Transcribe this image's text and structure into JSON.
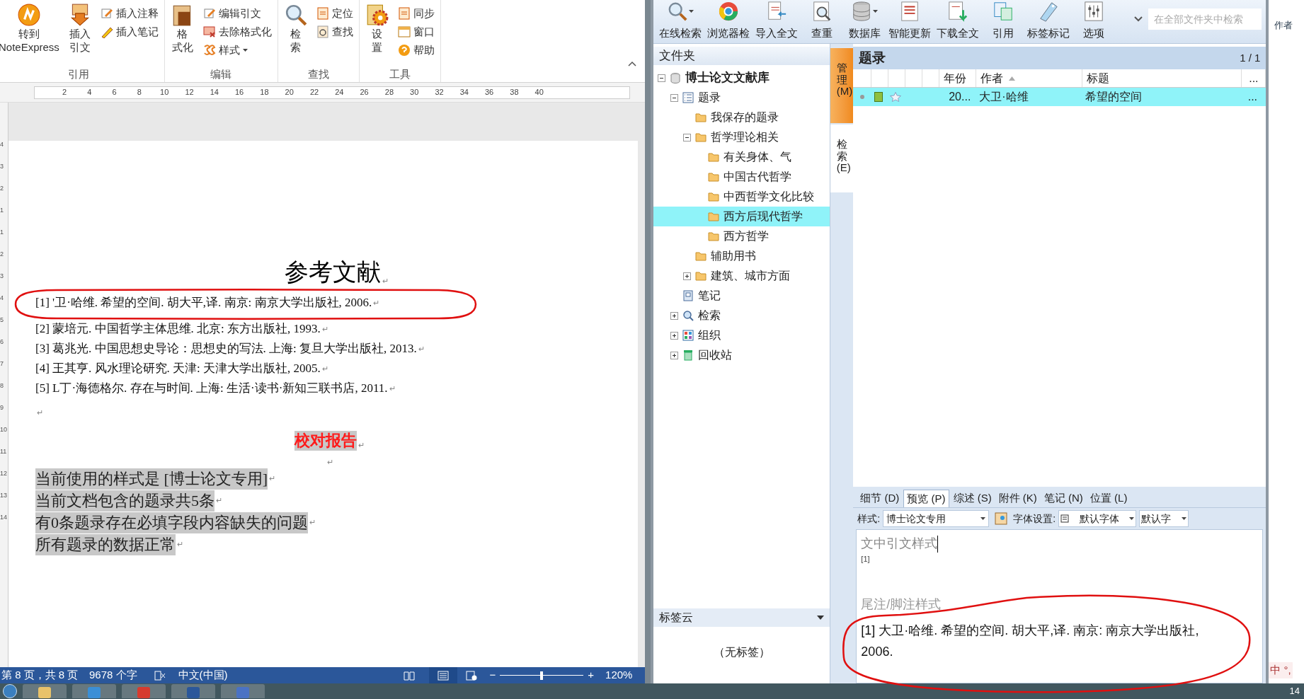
{
  "word": {
    "ribbon_groups": [
      {
        "label": "引用",
        "large": [
          {
            "lines": [
              "转到",
              "NoteExpress"
            ]
          },
          {
            "lines": [
              "插入",
              "引文"
            ]
          }
        ],
        "small": [
          {
            "label": "插入注释",
            "dropdown": false
          },
          {
            "label": "插入笔记",
            "dropdown": false
          }
        ]
      },
      {
        "label": "编辑",
        "large": [
          {
            "lines": [
              "格",
              "式化"
            ]
          }
        ],
        "small": [
          {
            "label": "编辑引文",
            "dropdown": false
          },
          {
            "label": "去除格式化",
            "dropdown": false
          },
          {
            "label": "样式",
            "dropdown": true
          }
        ]
      },
      {
        "label": "查找",
        "large": [
          {
            "lines": [
              "检",
              "索"
            ]
          }
        ],
        "small": [
          {
            "label": "定位",
            "dropdown": false
          },
          {
            "label": "查找",
            "dropdown": false
          }
        ]
      },
      {
        "label": "工具",
        "large": [
          {
            "lines": [
              "设",
              "置"
            ]
          }
        ],
        "small": [
          {
            "label": "同步",
            "dropdown": false
          },
          {
            "label": "窗口",
            "dropdown": false
          },
          {
            "label": "帮助",
            "dropdown": false
          }
        ]
      }
    ],
    "ruler_labels": [
      "2",
      "4",
      "6",
      "8",
      "10",
      "12",
      "14",
      "16",
      "18",
      "20",
      "22",
      "24",
      "26",
      "28",
      "30",
      "32",
      "34",
      "36",
      "38",
      "40"
    ],
    "vertical_ruler_labels": [
      "4",
      "3",
      "2",
      "1",
      "1",
      "2",
      "3",
      "4",
      "5",
      "6",
      "7",
      "8",
      "9",
      "10",
      "11",
      "12",
      "13",
      "14"
    ],
    "paragraph_mark": "↵",
    "title": "参考文献",
    "references": [
      "[1] '卫·哈维. 希望的空间. 胡大平,译. 南京: 南京大学出版社, 2006.",
      "[2]  蒙培元. 中国哲学主体思维. 北京: 东方出版社, 1993.",
      "[3]  葛兆光. 中国思想史导论：思想史的写法. 上海: 复旦大学出版社, 2013.",
      "[4]  王其亨. 风水理论研究. 天津: 天津大学出版社, 2005.",
      "[5] L丁·海德格尔. 存在与时间. 上海: 生活·读书·新知三联书店, 2011."
    ],
    "report_title": "校对报告",
    "report_lines": [
      "当前使用的样式是 [博士论文专用]",
      "当前文档包含的题录共5条",
      "有0条题录存在必填字段内容缺失的问题",
      "所有题录的数据正常"
    ],
    "status_bar": {
      "page": "第 8 页，共 8 页",
      "words": "9678 个字",
      "language": "中文(中国)",
      "zoom_out": "−",
      "zoom_slider": {
        "level": 0.5
      },
      "zoom_in": "+",
      "zoom": "120%"
    }
  },
  "noteexpress": {
    "toolbar": [
      {
        "label": "在线检索",
        "dropdown": true
      },
      {
        "label": "浏览器检",
        "dropdown": false
      },
      {
        "label": "导入全文",
        "dropdown": false
      },
      {
        "label": "查重",
        "dropdown": false
      },
      {
        "label": "数据库",
        "dropdown": true
      },
      {
        "label": "智能更新",
        "dropdown": false
      },
      {
        "label": "下载全文",
        "dropdown": false
      },
      {
        "label": "引用",
        "dropdown": false
      },
      {
        "label": "标签标记",
        "dropdown": false
      },
      {
        "label": "选项",
        "dropdown": false
      }
    ],
    "search": {
      "placeholder": "在全部文件夹中检索"
    },
    "folders_title": "文件夹",
    "tree": [
      {
        "label": "博士论文文献库",
        "kind": "database",
        "expanded": true,
        "selected": false,
        "children": [
          {
            "label": "题录",
            "kind": "list",
            "expanded": true,
            "selected": false,
            "children": [
              {
                "label": "我保存的题录",
                "kind": "folder",
                "selected": false
              },
              {
                "label": "哲学理论相关",
                "kind": "folder",
                "expanded": true,
                "selected": false,
                "children": [
                  {
                    "label": "有关身体、气",
                    "kind": "folder",
                    "selected": false
                  },
                  {
                    "label": "中国古代哲学",
                    "kind": "folder",
                    "selected": false
                  },
                  {
                    "label": "中西哲学文化比较",
                    "kind": "folder",
                    "selected": false
                  },
                  {
                    "label": "西方后现代哲学",
                    "kind": "folder",
                    "selected": true
                  },
                  {
                    "label": "西方哲学",
                    "kind": "folder",
                    "selected": false
                  }
                ]
              },
              {
                "label": "辅助用书",
                "kind": "folder",
                "selected": false
              },
              {
                "label": "建筑、城市方面",
                "kind": "folder",
                "expanded": false,
                "selected": false
              }
            ]
          },
          {
            "label": "笔记",
            "kind": "notes",
            "selected": false
          },
          {
            "label": "检索",
            "kind": "search",
            "expanded": false,
            "selected": false
          },
          {
            "label": "组织",
            "kind": "organize",
            "expanded": false,
            "selected": false
          },
          {
            "label": "回收站",
            "kind": "trash",
            "expanded": false,
            "selected": false
          }
        ]
      }
    ],
    "tag_cloud": {
      "title": "标签云",
      "empty": "（无标签）"
    },
    "side_tabs": [
      {
        "label": "管理(M)",
        "selected": true
      },
      {
        "label": "检索(E)",
        "selected": false
      }
    ],
    "records": {
      "title": "题录",
      "count": "1 / 1",
      "columns": [
        {
          "label": "年份",
          "sorted_ascending": false
        },
        {
          "label": "作者",
          "sorted_ascending": true
        },
        {
          "label": "标题",
          "sorted_ascending": false
        },
        {
          "label": "...",
          "sorted_ascending": false
        }
      ],
      "rows": [
        {
          "selected": true,
          "year": "20...",
          "author": "大卫·哈维",
          "title": "希望的空间",
          "more": "..."
        }
      ]
    },
    "detail_tabs": [
      {
        "label": "细节 (D)",
        "selected": false
      },
      {
        "label": "预览 (P)",
        "selected": true
      },
      {
        "label": "综述 (S)",
        "selected": false
      },
      {
        "label": "附件 (K)",
        "selected": false
      },
      {
        "label": "笔记 (N)",
        "selected": false
      },
      {
        "label": "位置 (L)",
        "selected": false
      }
    ],
    "style_row": {
      "style_label": "样式:",
      "style_value": "博士论文专用",
      "font_label": "字体设置:",
      "font_value": "默认字体",
      "size_value": "默认字"
    },
    "preview": {
      "intext_heading": "文中引文样式",
      "intext": "[1]",
      "footnote_heading": "尾注/脚注样式",
      "footnote": "[1] 大卫·哈维. 希望的空间. 胡大平,译. 南京: 南京大学出版社, 2006."
    }
  },
  "background_window": {
    "column_label": "作者",
    "ime": "中 °,"
  },
  "taskbar": {
    "clock": "14"
  }
}
